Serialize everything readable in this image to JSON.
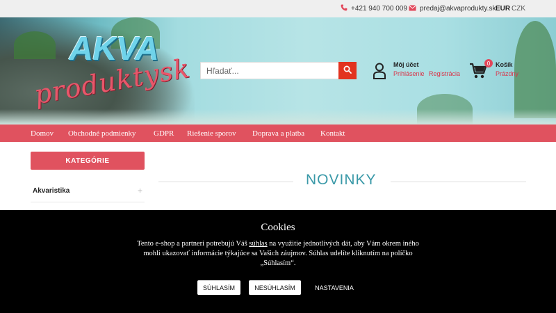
{
  "topbar": {
    "phone": "+421 940 700 009",
    "email": "predaj@akvaprodukty.sk",
    "currencies": [
      "EUR",
      "CZK"
    ]
  },
  "logo": {
    "line1": "AKVA",
    "line2": "produktysk"
  },
  "search": {
    "placeholder": "Hľadať..."
  },
  "account": {
    "title": "Môj účet",
    "login": "Prihlásenie",
    "register": "Registrácia"
  },
  "cart": {
    "title": "Košík",
    "count": "0",
    "status": "Prázdny"
  },
  "nav": [
    "Domov",
    "Obchodné podmienky",
    "GDPR",
    "Riešenie sporov",
    "Doprava a platba",
    "Kontakt"
  ],
  "sidebar": {
    "header": "KATEGÓRIE",
    "items": [
      {
        "label": "Akvaristika",
        "expand": "+"
      }
    ]
  },
  "main": {
    "section_title": "NOVINKY"
  },
  "cookies": {
    "title": "Cookies",
    "text_before": "Tento e-shop a partneri potrebujú Váš ",
    "link": "súhlas",
    "text_after": " na využitie jednotlivých dát, aby Vám okrem iného mohli ukazovať informácie týkajúce sa Vašich záujmov. Súhlas udelíte kliknutím na políčko „Súhlasím“.",
    "accept": "SÚHLASÍM",
    "reject": "NESÚHLASÍM",
    "settings": "NASTAVENIA"
  },
  "colors": {
    "accent": "#e0525f",
    "search_button": "#e2331f",
    "title": "#3a99a8"
  }
}
